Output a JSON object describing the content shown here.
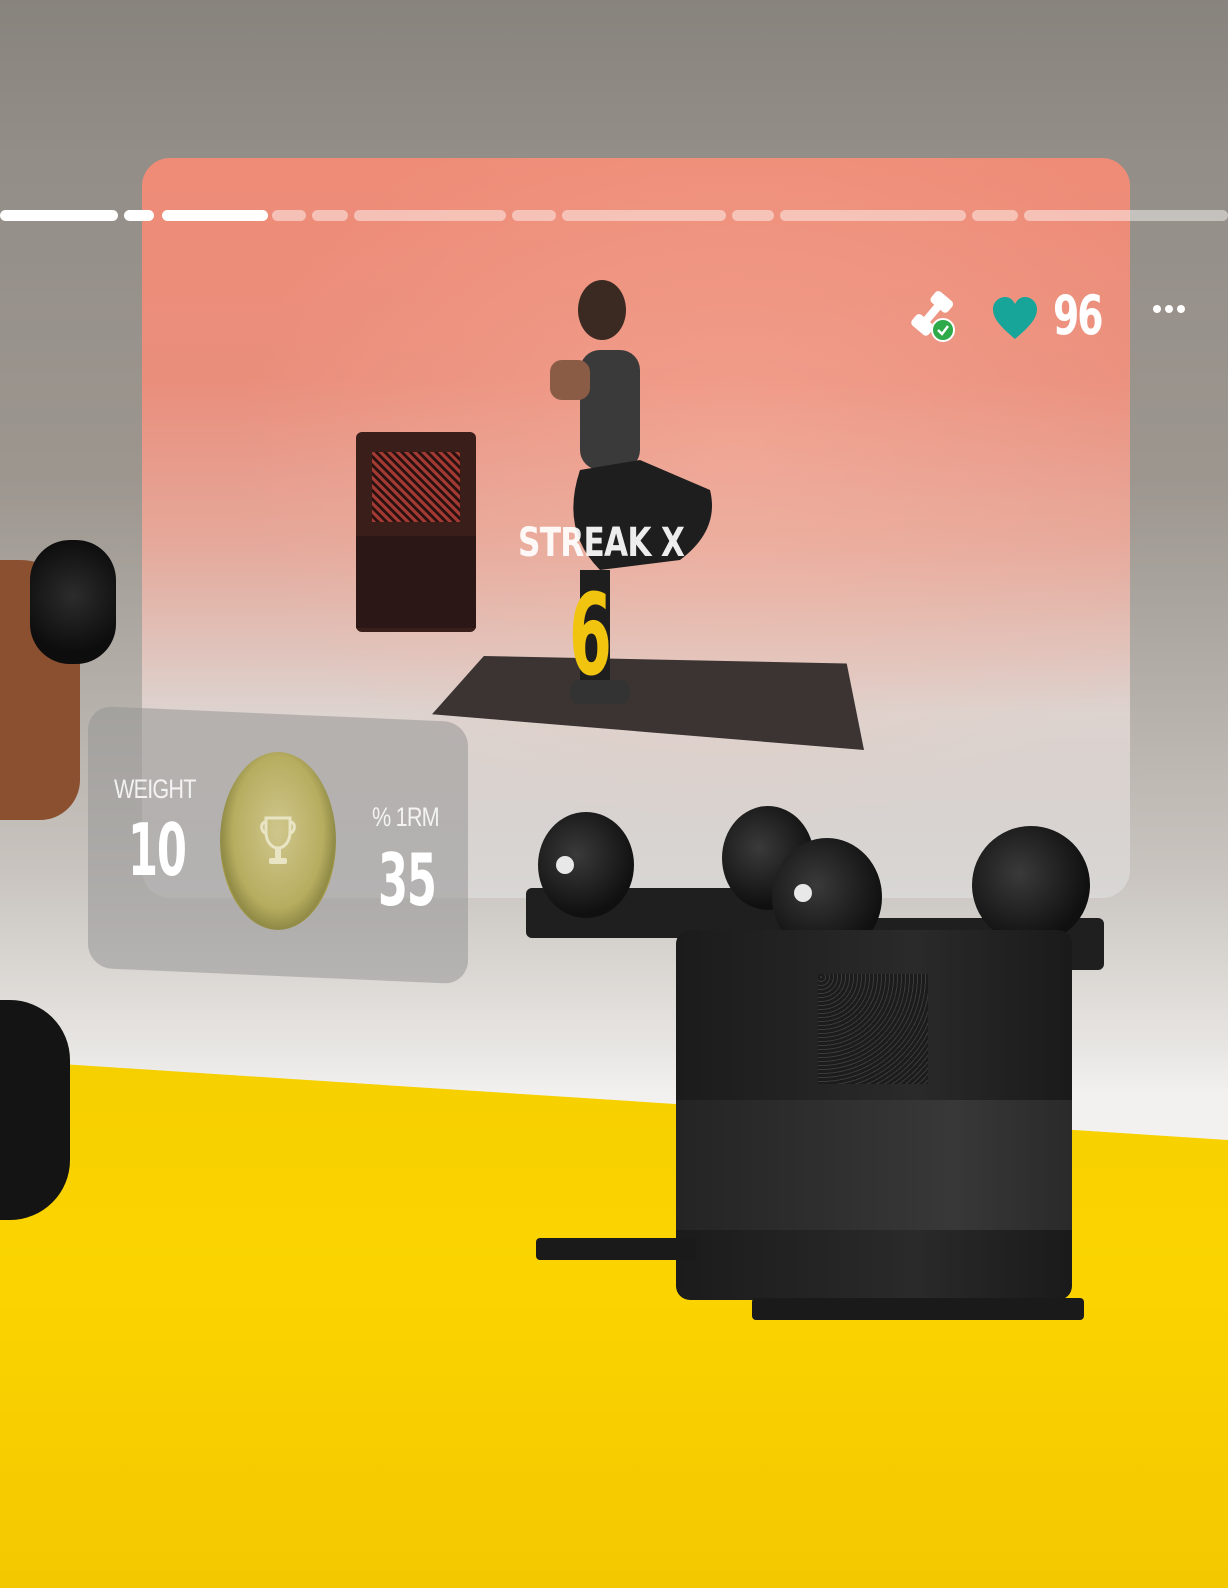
{
  "workout": {
    "streak_label": "STREAK X",
    "streak_count": "6"
  },
  "status": {
    "equipment_icon": "dumbbell-connected-icon",
    "heart_icon": "heart-icon",
    "heart_rate": "96",
    "more_icon": "more-options-icon"
  },
  "stats": {
    "weight_label": "WEIGHT",
    "weight_value": "10",
    "one_rm_label": "% 1RM",
    "one_rm_value": "35",
    "trophy_icon": "trophy-icon"
  },
  "progress": {
    "completed_segments": 3,
    "total_segments": 12
  },
  "colors": {
    "panel": "#ee8c77",
    "streak_accent": "#f1c40f",
    "heart": "#17a59a",
    "check": "#2eaa4a",
    "floor": "#fbd400"
  }
}
